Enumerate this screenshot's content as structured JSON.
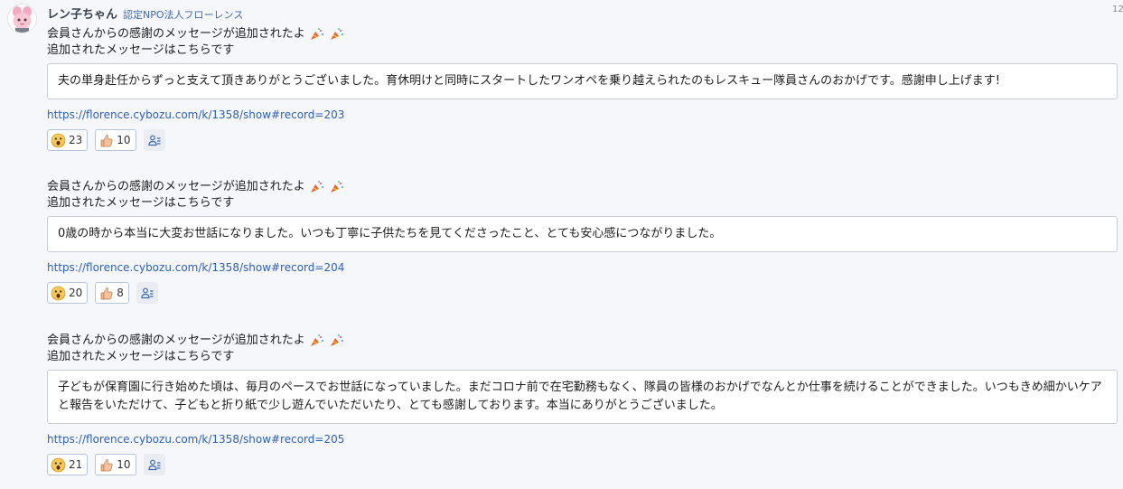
{
  "sender": {
    "name": "レン子ちゃん",
    "org": "認定NPO法人フローレンス",
    "time": "12"
  },
  "messages": [
    {
      "intro": "会員さんからの感謝のメッセージが追加されたよ",
      "sub": "追加されたメッセージはこちらです",
      "quote": "夫の単身赴任からずっと支えて頂きありがとうございました。育休明けと同時にスタートしたワンオペを乗り越えられたのもレスキュー隊員さんのおかげです。感謝申し上げます!",
      "link": "https://florence.cybozu.com/k/1358/show#record=203",
      "reactions": {
        "wow": "23",
        "thumbs": "10"
      }
    },
    {
      "intro": "会員さんからの感謝のメッセージが追加されたよ",
      "sub": "追加されたメッセージはこちらです",
      "quote": "0歳の時から本当に大変お世話になりました。いつも丁寧に子供たちを見てくださったこと、とても安心感につながりました。",
      "link": "https://florence.cybozu.com/k/1358/show#record=204",
      "reactions": {
        "wow": "20",
        "thumbs": "8"
      }
    },
    {
      "intro": "会員さんからの感謝のメッセージが追加されたよ",
      "sub": "追加されたメッセージはこちらです",
      "quote": "子どもが保育園に行き始めた頃は、毎月のペースでお世話になっていました。まだコロナ前で在宅勤務もなく、隊員の皆様のおかげでなんとか仕事を続けることができました。いつもきめ細かいケアと報告をいただけて、子どもと折り紙で少し遊んでいただいたり、とても感謝しております。本当にありがとうございました。",
      "link": "https://florence.cybozu.com/k/1358/show#record=205",
      "reactions": {
        "wow": "21",
        "thumbs": "10"
      }
    }
  ],
  "icons": {
    "avatar": "character-avatar",
    "celebrate": "party-popper-icon",
    "reaction_1": "face-screaming-icon",
    "reaction_2": "thumbs-up-icon",
    "reacted_users": "people-list-icon"
  },
  "colors": {
    "link": "#2d62b3",
    "org": "#3d6aa8",
    "reaction_border": "#b5c6dc",
    "background": "#f6f7fb"
  }
}
